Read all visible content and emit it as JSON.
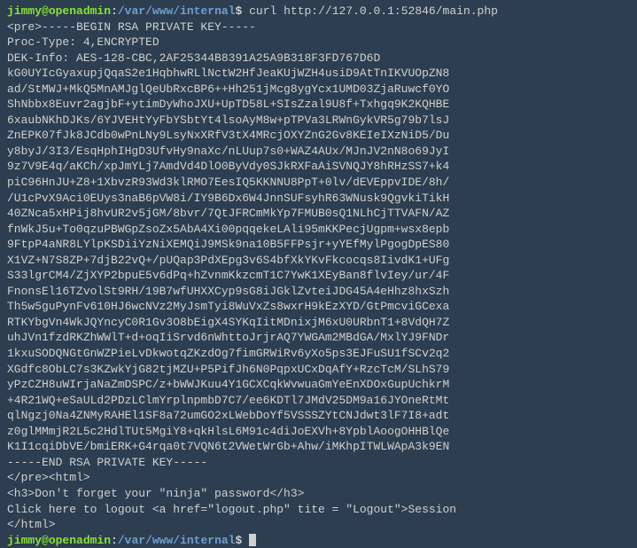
{
  "prompt1": {
    "user": "jimmy",
    "at": "@",
    "host": "openadmin",
    "colon": ":",
    "path": "/var/www/internal",
    "dollar": "$",
    "command": " curl http://127.0.0.1:52846/main.php"
  },
  "output": {
    "pre_open": "<pre>-----BEGIN RSA PRIVATE KEY-----",
    "proc_type": "Proc-Type: 4,ENCRYPTED",
    "dek_info": "DEK-Info: AES-128-CBC,2AF25344B8391A25A9B318F3FD767D6D",
    "blank": "",
    "key_lines": [
      "kG0UYIcGyaxupjQqaS2e1HqbhwRLlNctW2HfJeaKUjWZH4usiD9AtTnIKVUOpZN8",
      "ad/StMWJ+MkQ5MnAMJglQeUbRxcBP6++Hh251jMcg8ygYcx1UMD03ZjaRuwcf0YO",
      "ShNbbx8Euvr2agjbF+ytimDyWhoJXU+UpTD58L+SIsZzal9U8f+Txhgq9K2KQHBE",
      "6xaubNKhDJKs/6YJVEHtYyFbYSbtYt4lsoAyM8w+pTPVa3LRWnGykVR5g79b7lsJ",
      "ZnEPK07fJk8JCdb0wPnLNy9LsyNxXRfV3tX4MRcjOXYZnG2Gv8KEIeIXzNiD5/Du",
      "y8byJ/3I3/EsqHphIHgD3UfvHy9naXc/nLUup7s0+WAZ4AUx/MJnJV2nN8o69JyI",
      "9z7V9E4q/aKCh/xpJmYLj7AmdVd4DlO0ByVdy0SJkRXFaAiSVNQJY8hRHzSS7+k4",
      "piC96HnJU+Z8+1XbvzR93Wd3klRMO7EesIQ5KKNNU8PpT+0lv/dEVEppvIDE/8h/",
      "/U1cPvX9Aci0EUys3naB6pVW8i/IY9B6Dx6W4JnnSUFsyhR63WNusk9QgvkiTikH",
      "40ZNca5xHPij8hvUR2v5jGM/8bvr/7QtJFRCmMkYp7FMUB0sQ1NLhCjTTVAFN/AZ",
      "fnWkJ5u+To0qzuPBWGpZsoZx5AbA4Xi00pqqekeLAli95mKKPecjUgpm+wsx8epb",
      "9FtpP4aNR8LYlpKSDiiYzNiXEMQiJ9MSk9na10B5FFPsjr+yYEfMylPgogDpES80",
      "X1VZ+N7S8ZP+7djB22vQ+/pUQap3PdXEpg3v6S4bfXkYKvFkcocqs8IivdK1+UFg",
      "S33lgrCM4/ZjXYP2bpuE5v6dPq+hZvnmKkzcmT1C7YwK1XEyBan8flvIey/ur/4F",
      "FnonsEl16TZvolSt9RH/19B7wfUHXXCyp9sG8iJGklZvteiJDG45A4eHhz8hxSzh",
      "Th5w5guPynFv610HJ6wcNVz2MyJsmTyi8WuVxZs8wxrH9kEzXYD/GtPmcviGCexa",
      "RTKYbgVn4WkJQYncyC0R1Gv3O8bEigX4SYKqIitMDnixjM6xU0URbnT1+8VdQH7Z",
      "uhJVn1fzdRKZhWWlT+d+oqIiSrvd6nWhttoJrjrAQ7YWGAm2MBdGA/MxlYJ9FNDr",
      "1kxuSODQNGtGnWZPieLvDkwotqZKzdOg7fimGRWiRv6yXo5ps3EJFuSU1fSCv2q2",
      "XGdfc8ObLC7s3KZwkYjG82tjMZU+P5PifJh6N0PqpxUCxDqAfY+RzcTcM/SLhS79",
      "yPzCZH8uWIrjaNaZmDSPC/z+bWWJKuu4Y1GCXCqkWvwuaGmYeEnXDOxGupUchkrM",
      "+4R21WQ+eSaULd2PDzLClmYrplnpmbD7C7/ee6KDTl7JMdV25DM9a16JYOneRtMt",
      "qlNgzj0Na4ZNMyRAHEl1SF8a72umGO2xLWebDoYf5VSSSZYtCNJdwt3lF7I8+adt",
      "z0glMMmjR2L5c2HdlTUt5MgiY8+qkHlsL6M91c4diJoEXVh+8YpblAoogOHHBlQe",
      "K1I1cqiDbVE/bmiERK+G4rqa0t7VQN6t2VWetWrGb+Ahw/iMKhpITWLWApA3k9EN"
    ],
    "end_key": "-----END RSA PRIVATE KEY-----",
    "pre_close": "</pre><html>",
    "h3": "<h3>Don't forget your \"ninja\" password</h3>",
    "logout": "Click here to logout <a href=\"logout.php\" tite = \"Logout\">Session",
    "html_close": "</html>"
  },
  "prompt2": {
    "user": "jimmy",
    "at": "@",
    "host": "openadmin",
    "colon": ":",
    "path": "/var/www/internal",
    "dollar": "$",
    "command": " "
  }
}
